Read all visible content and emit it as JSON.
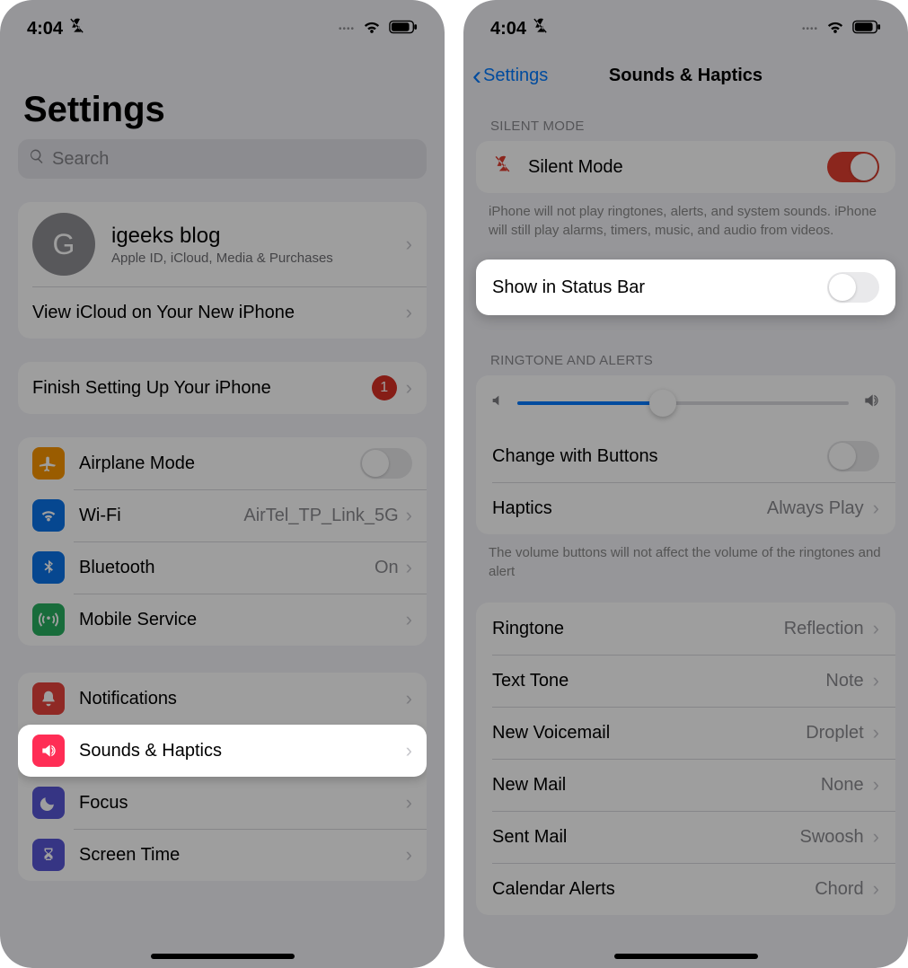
{
  "left": {
    "status": {
      "time": "4:04"
    },
    "title": "Settings",
    "search_placeholder": "Search",
    "account": {
      "initial": "G",
      "name": "igeeks blog",
      "subtitle": "Apple ID, iCloud, Media & Purchases"
    },
    "icloud_row": "View iCloud on Your New iPhone",
    "finish_setup": {
      "label": "Finish Setting Up Your iPhone",
      "badge": "1"
    },
    "network": {
      "airplane": "Airplane Mode",
      "wifi": {
        "label": "Wi-Fi",
        "value": "AirTel_TP_Link_5G"
      },
      "bluetooth": {
        "label": "Bluetooth",
        "value": "On"
      },
      "mobile": "Mobile Service"
    },
    "personal": {
      "notifications": "Notifications",
      "sounds": "Sounds & Haptics",
      "focus": "Focus",
      "screentime": "Screen Time"
    }
  },
  "right": {
    "status": {
      "time": "4:04"
    },
    "back": "Settings",
    "title": "Sounds & Haptics",
    "silent_header": "SILENT MODE",
    "silent_label": "Silent Mode",
    "silent_footer": "iPhone will not play ringtones, alerts, and system sounds. iPhone will still play alarms, timers, music, and audio from videos.",
    "show_status": "Show in Status Bar",
    "ringtone_header": "RINGTONE AND ALERTS",
    "change_buttons": "Change with Buttons",
    "haptics": {
      "label": "Haptics",
      "value": "Always Play"
    },
    "ringtone_footer": "The volume buttons will not affect the volume of the ringtones and alert",
    "slider_value": 44,
    "sounds": {
      "ringtone": {
        "label": "Ringtone",
        "value": "Reflection"
      },
      "text": {
        "label": "Text Tone",
        "value": "Note"
      },
      "voicemail": {
        "label": "New Voicemail",
        "value": "Droplet"
      },
      "mail": {
        "label": "New Mail",
        "value": "None"
      },
      "sent": {
        "label": "Sent Mail",
        "value": "Swoosh"
      },
      "calendar": {
        "label": "Calendar Alerts",
        "value": "Chord"
      }
    }
  }
}
